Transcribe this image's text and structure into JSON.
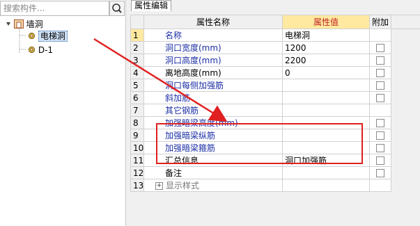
{
  "search": {
    "placeholder": "搜索构件..."
  },
  "tree": {
    "root_label": "墙洞",
    "children": [
      {
        "label": "电梯洞"
      },
      {
        "label": "D-1"
      }
    ]
  },
  "panel": {
    "tab_label": "属性编辑"
  },
  "table": {
    "headers": {
      "name": "属性名称",
      "value": "属性值",
      "extra": "附加"
    },
    "rows": [
      {
        "num": "1",
        "name": "名称",
        "value": "电梯洞",
        "checkbox": false
      },
      {
        "num": "2",
        "name": "洞口宽度(mm)",
        "value": "1200",
        "checkbox": true
      },
      {
        "num": "3",
        "name": "洞口高度(mm)",
        "value": "2200",
        "checkbox": true
      },
      {
        "num": "4",
        "name": "离地高度(mm)",
        "value": "0",
        "checkbox": true
      },
      {
        "num": "5",
        "name": "洞口每侧加强筋",
        "value": "",
        "checkbox": true
      },
      {
        "num": "6",
        "name": "斜加筋",
        "value": "",
        "checkbox": true
      },
      {
        "num": "7",
        "name": "其它钢筋",
        "value": "",
        "checkbox": false
      },
      {
        "num": "8",
        "name": "加强暗梁高度(mm)",
        "value": "",
        "checkbox": true
      },
      {
        "num": "9",
        "name": "加强暗梁纵筋",
        "value": "",
        "checkbox": true
      },
      {
        "num": "10",
        "name": "加强暗梁箍筋",
        "value": "",
        "checkbox": true
      },
      {
        "num": "11",
        "name": "汇总信息",
        "value": "洞口加强筋",
        "checkbox": true
      },
      {
        "num": "12",
        "name": "备注",
        "value": "",
        "checkbox": true
      },
      {
        "num": "13",
        "name": "显示样式",
        "value": "",
        "checkbox": false
      }
    ]
  },
  "colors": {
    "annotation": "#e02020",
    "label_blue": "#1c2fa5",
    "header_highlight": "#ffe9a0"
  }
}
